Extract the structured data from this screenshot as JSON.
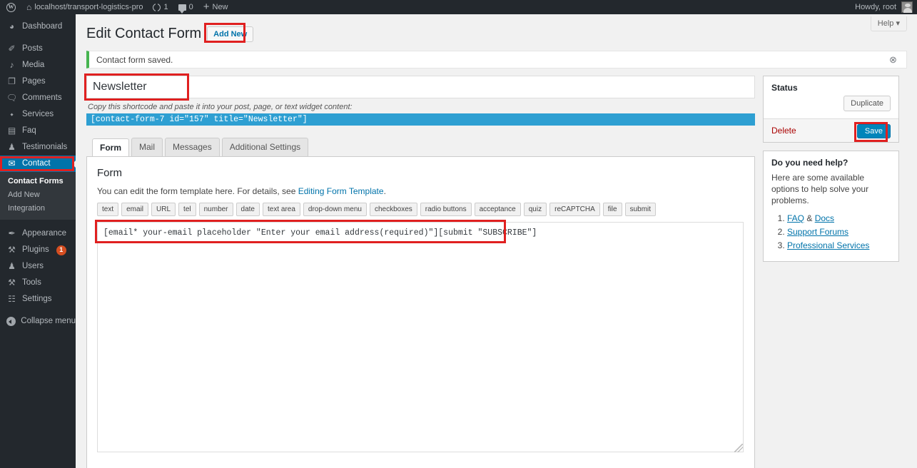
{
  "adminbar": {
    "logo_glyph": "W",
    "site_name": "localhost/transport-logistics-pro",
    "updates_count": "1",
    "comments_count": "0",
    "new_label": "New",
    "howdy": "Howdy, root"
  },
  "sidebar": {
    "items": [
      {
        "label": "Dashboard",
        "icon": "dashboard-icon",
        "glyph": "◔"
      },
      {
        "label": "Posts",
        "icon": "pin-icon",
        "glyph": "✐"
      },
      {
        "label": "Media",
        "icon": "media-icon",
        "glyph": "♫"
      },
      {
        "label": "Pages",
        "icon": "pages-icon",
        "glyph": "❐"
      },
      {
        "label": "Comments",
        "icon": "comment-icon",
        "glyph": "■"
      },
      {
        "label": "Services",
        "icon": "tag-icon",
        "glyph": "⬩"
      },
      {
        "label": "Faq",
        "icon": "faq-icon",
        "glyph": "▤"
      },
      {
        "label": "Testimonials",
        "icon": "testimonials-icon",
        "glyph": "♟"
      },
      {
        "label": "Contact",
        "icon": "envelope-icon",
        "glyph": "✉"
      }
    ],
    "submenu": [
      {
        "label": "Contact Forms",
        "current": true
      },
      {
        "label": "Add New",
        "current": false
      },
      {
        "label": "Integration",
        "current": false
      }
    ],
    "lower_items": [
      {
        "label": "Appearance",
        "icon": "brush-icon",
        "glyph": "✒",
        "badge": ""
      },
      {
        "label": "Plugins",
        "icon": "plug-icon",
        "glyph": "⚒",
        "badge": "1"
      },
      {
        "label": "Users",
        "icon": "users-icon",
        "glyph": "♟",
        "badge": ""
      },
      {
        "label": "Tools",
        "icon": "wrench-icon",
        "glyph": "⚒",
        "badge": ""
      },
      {
        "label": "Settings",
        "icon": "settings-icon",
        "glyph": "☷",
        "badge": ""
      }
    ],
    "collapse_label": "Collapse menu"
  },
  "header": {
    "help_tab_label": "Help ▾",
    "page_title": "Edit Contact Form",
    "add_new_label": "Add New"
  },
  "notice": {
    "message": "Contact form saved.",
    "dismiss_icon": "⊗",
    "accent_color": "#46b450"
  },
  "form": {
    "title_value": "Newsletter",
    "shortcode_hint": "Copy this shortcode and paste it into your post, page, or text widget content:",
    "shortcode_value": "[contact-form-7 id=\"157\" title=\"Newsletter\"]",
    "shortcode_highlight_color": "#2e9fd2",
    "tabs": [
      {
        "label": "Form",
        "active": true
      },
      {
        "label": "Mail",
        "active": false
      },
      {
        "label": "Messages",
        "active": false
      },
      {
        "label": "Additional Settings",
        "active": false
      }
    ],
    "panel_heading": "Form",
    "panel_desc_pre": "You can edit the form template here. For details, see ",
    "panel_desc_link": "Editing Form Template",
    "panel_desc_post": ".",
    "tag_buttons": [
      "text",
      "email",
      "URL",
      "tel",
      "number",
      "date",
      "text area",
      "drop-down menu",
      "checkboxes",
      "radio buttons",
      "acceptance",
      "quiz",
      "reCAPTCHA",
      "file",
      "submit"
    ],
    "template_value": "[email* your-email placeholder \"Enter your email address(required)\"][submit \"SUBSCRIBE\"]"
  },
  "status_box": {
    "title": "Status",
    "duplicate_label": "Duplicate",
    "delete_label": "Delete",
    "save_label": "Save"
  },
  "help_box": {
    "title": "Do you need help?",
    "intro": "Here are some available options to help solve your problems.",
    "links": [
      {
        "prefix": "",
        "label": "FAQ",
        "suffix": " & ",
        "label2": "Docs"
      },
      {
        "prefix": "",
        "label": "Support Forums",
        "suffix": "",
        "label2": ""
      },
      {
        "prefix": "",
        "label": "Professional Services",
        "suffix": "",
        "label2": ""
      }
    ]
  },
  "highlight_color": "#e02020"
}
